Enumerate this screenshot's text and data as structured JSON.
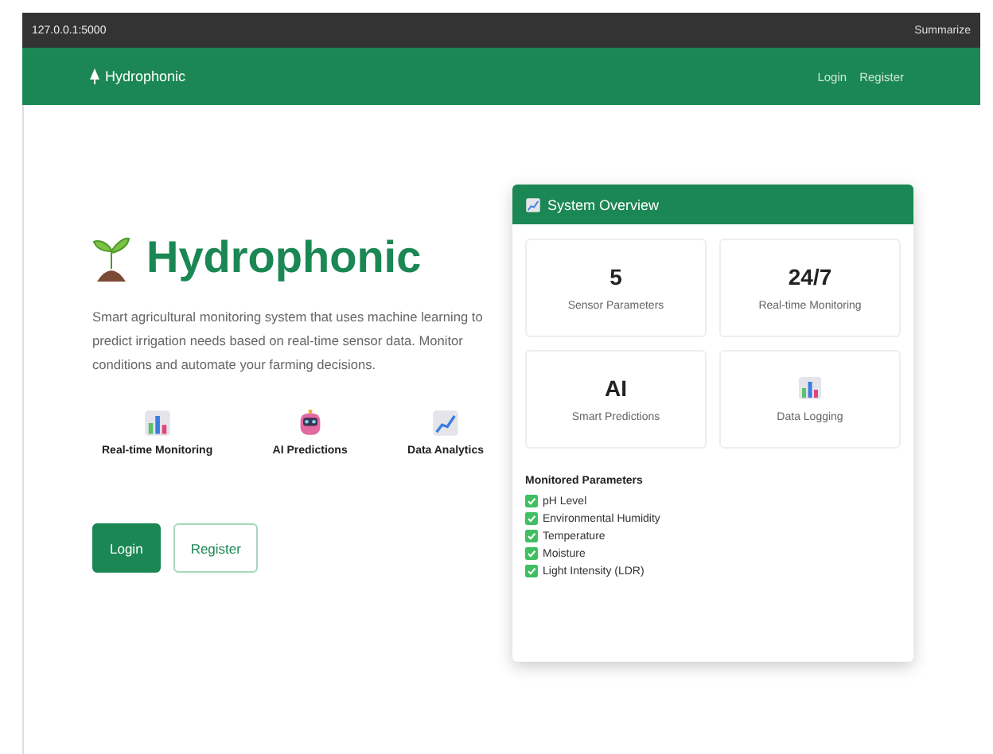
{
  "browser": {
    "url": "127.0.0.1:5000",
    "summarize": "Summarize"
  },
  "navbar": {
    "brand": "Hydrophonic",
    "links": [
      "Login",
      "Register"
    ]
  },
  "hero": {
    "title": "Hydrophonic",
    "description": "Smart agricultural monitoring system that uses machine learning to predict irrigation needs based on real-time sensor data. Monitor conditions and automate your farming decisions.",
    "features": [
      {
        "kind": "chart",
        "label": "Real-time Monitoring"
      },
      {
        "kind": "robot",
        "label": "AI Predictions"
      },
      {
        "kind": "trend",
        "label": "Data Analytics"
      }
    ],
    "buttons": [
      {
        "label": "Login",
        "kind": "primary"
      },
      {
        "label": "Register",
        "kind": "outline"
      }
    ]
  },
  "overview": {
    "title": "System Overview",
    "stats": [
      {
        "value": "5",
        "label": "Sensor Parameters"
      },
      {
        "value": "24/7",
        "label": "Real-time Monitoring"
      },
      {
        "value": "AI",
        "label": "Smart Predictions"
      },
      {
        "kind": "chart",
        "label": "Data Logging"
      }
    ],
    "parameters_title": "Monitored Parameters",
    "parameters": [
      "pH Level",
      "Environmental Humidity",
      "Temperature",
      "Moisture",
      "Light Intensity (LDR)"
    ]
  }
}
